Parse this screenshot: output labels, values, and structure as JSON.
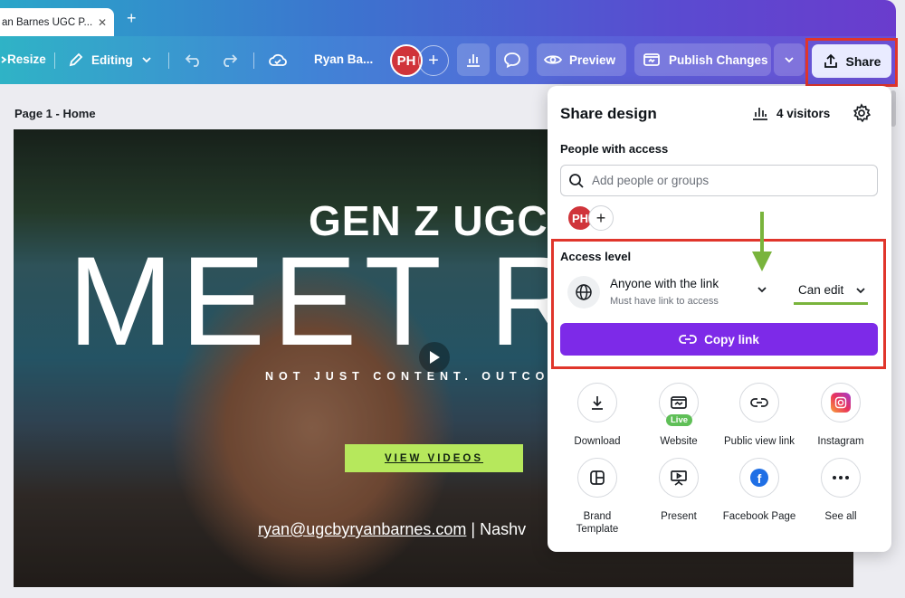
{
  "browser": {
    "tab_title": "an Barnes UGC P...",
    "tab_close": "✕",
    "new_tab": "+"
  },
  "toolbar": {
    "resize_label": "Resize",
    "editing_label": "Editing",
    "doc_name": "Ryan Ba...",
    "avatar_initials": "PH",
    "add_label": "+",
    "preview_label": "Preview",
    "publish_label": "Publish Changes",
    "share_label": "Share"
  },
  "page": {
    "label": "Page 1 - Home"
  },
  "canvas": {
    "subtitle": "GEN Z UGC",
    "title": "MEET RY",
    "tagline": "NOT JUST CONTENT. OUTCO",
    "cta": "VIEW VIDEOS",
    "email": "ryan@ugcbyryanbarnes.com",
    "email_suffix": " | Nashv"
  },
  "share_panel": {
    "title": "Share design",
    "visitors": "4 visitors",
    "people_heading": "People with access",
    "search_placeholder": "Add people or groups",
    "avatar_initials": "PH",
    "access_heading": "Access level",
    "access_option": "Anyone with the link",
    "access_desc": "Must have link to access",
    "permission": "Can edit",
    "copy_link": "Copy link",
    "live_badge": "Live",
    "actions": [
      {
        "label": "Download",
        "icon": "download-icon"
      },
      {
        "label": "Website",
        "icon": "website-icon"
      },
      {
        "label": "Public view link",
        "icon": "link-icon"
      },
      {
        "label": "Instagram",
        "icon": "instagram-icon"
      },
      {
        "label": "Brand\nTemplate",
        "icon": "brand-template-icon"
      },
      {
        "label": "Present",
        "icon": "present-icon"
      },
      {
        "label": "Facebook Page",
        "icon": "facebook-icon"
      },
      {
        "label": "See all",
        "icon": "more-icon"
      }
    ]
  },
  "colors": {
    "accent": "#7d2ae8",
    "highlight_border": "#e0352b",
    "annotation_green": "#79b43c",
    "cta_green": "#b6e85c",
    "avatar_red": "#d0343a"
  }
}
